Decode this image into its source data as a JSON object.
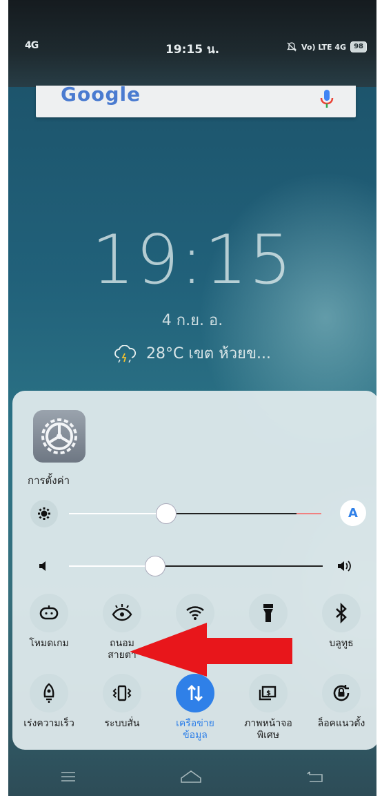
{
  "status_bar": {
    "network_left": "4G",
    "time": "19:15 น.",
    "network_right": "Vo) LTE 4G",
    "battery": "98"
  },
  "search_bar": {
    "logo": "Google"
  },
  "lock_clock": {
    "time": "19:15",
    "date": "4 ก.ย.  อ.",
    "weather": "28°C เขต ห้วยข..."
  },
  "panel": {
    "settings_label": "การตั้งค่า",
    "brightness": {
      "auto_label": "A",
      "level": 0.42
    },
    "volume": {
      "level": 0.32
    },
    "tiles_row1": [
      {
        "label": "โหมดเกม",
        "icon": "gamepad-icon"
      },
      {
        "label": "ถนอม\nสายตา",
        "icon": "eye-icon"
      },
      {
        "label": "",
        "icon": "wifi-icon"
      },
      {
        "label": "",
        "icon": "flashlight-icon"
      },
      {
        "label": "บลูทูธ",
        "icon": "bluetooth-icon"
      }
    ],
    "tiles_row2": [
      {
        "label": "เร่งความเร็ว",
        "icon": "rocket-icon"
      },
      {
        "label": "ระบบสั่น",
        "icon": "vibrate-icon"
      },
      {
        "label": "เครือข่าย\nข้อมูล",
        "icon": "mobile-data-icon",
        "active": true
      },
      {
        "label": "ภาพหน้าจอ\nพิเศษ",
        "icon": "screenshot-icon"
      },
      {
        "label": "ล็อคแนวตั้ง",
        "icon": "rotation-lock-icon"
      }
    ]
  },
  "colors": {
    "accent": "#2f80e8",
    "arrow": "#e8161b"
  }
}
